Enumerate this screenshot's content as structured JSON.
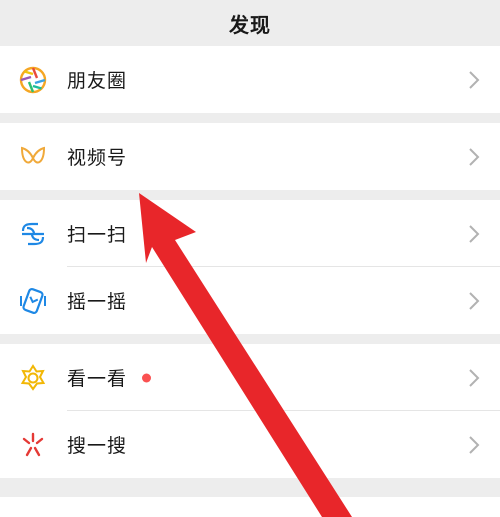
{
  "header": {
    "title": "发现"
  },
  "sections": [
    {
      "items": [
        {
          "label": "朋友圈",
          "icon": "moments-icon"
        }
      ]
    },
    {
      "items": [
        {
          "label": "视频号",
          "icon": "channels-icon"
        }
      ]
    },
    {
      "items": [
        {
          "label": "扫一扫",
          "icon": "scan-icon"
        },
        {
          "label": "摇一摇",
          "icon": "shake-icon"
        }
      ]
    },
    {
      "items": [
        {
          "label": "看一看",
          "icon": "top-stories-icon",
          "badge": "red-dot"
        },
        {
          "label": "搜一搜",
          "icon": "search-icon"
        }
      ]
    }
  ],
  "colors": {
    "background": "#ededed",
    "cell": "#ffffff",
    "text": "#191919",
    "chevron": "#b2b2b2",
    "badge": "#fa5151",
    "annotation_arrow": "#e8262a"
  }
}
